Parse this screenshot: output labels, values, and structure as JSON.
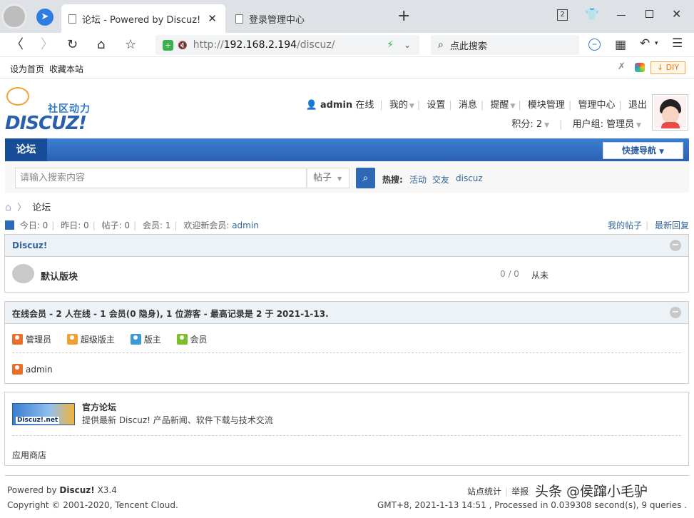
{
  "browser": {
    "tabs": [
      {
        "title": "论坛 - Powered by Discuz!",
        "active": true
      },
      {
        "title": "登录管理中心",
        "active": false
      }
    ],
    "tab_count": "2",
    "url_prefix": "http://",
    "url_host": "192.168.2.194",
    "url_path": "/discuz/",
    "search_placeholder": "点此搜索",
    "bookmarks": [
      "设为首页",
      "收藏本站"
    ],
    "diy_label": "DIY"
  },
  "site": {
    "logo_tagline": "社区动力",
    "logo_text": "DISCUZ!",
    "user": {
      "name": "admin",
      "status": "在线",
      "links": [
        "我的",
        "设置",
        "消息",
        "提醒",
        "模块管理",
        "管理中心",
        "退出"
      ],
      "credits_label": "积分: 2",
      "usergroup_label": "用户组: 管理员"
    },
    "nav": {
      "current": "论坛",
      "quick_nav": "快捷导航"
    },
    "search": {
      "placeholder": "请输入搜索内容",
      "type": "帖子",
      "hot_label": "热搜:",
      "hot_terms": [
        "活动",
        "交友",
        "discuz"
      ]
    },
    "breadcrumb": "论坛",
    "stats": {
      "today": "今日: 0",
      "yesterday": "昨日: 0",
      "posts": "帖子: 0",
      "members": "会员: 1",
      "welcome_prefix": "欢迎新会员:",
      "newest_member": "admin",
      "my_posts": "我的帖子",
      "latest_reply": "最新回复"
    },
    "category": {
      "title": "Discuz!",
      "forums": [
        {
          "name": "默认版块",
          "counts": "0 / 0",
          "last": "从未"
        }
      ]
    },
    "online": {
      "title": "在线会员 - 2 人在线 - 1 会员(0 隐身), 1 位游客 - 最高记录是 2 于 2021-1-13.",
      "legend": [
        {
          "label": "管理员",
          "color": "#e8702a"
        },
        {
          "label": "超级版主",
          "color": "#f0a030"
        },
        {
          "label": "版主",
          "color": "#3a9ad9"
        },
        {
          "label": "会员",
          "color": "#7bbf2a"
        }
      ],
      "users": [
        "admin"
      ]
    },
    "links": {
      "site_name": "官方论坛",
      "site_desc": "提供最新 Discuz! 产品新闻、软件下载与技术交流",
      "banner_text": "Discuz!.net",
      "app_store": "应用商店"
    },
    "footer": {
      "powered_prefix": "Powered by",
      "powered_name": "Discuz!",
      "version": "X3.4",
      "copyright": "Copyright © 2001-2020, Tencent Cloud.",
      "links": [
        "站点统计",
        "举报"
      ],
      "time_info": "GMT+8, 2021-1-13 14:51 , Processed in 0.039308 second(s), 9 queries .",
      "watermark": "头条 @侯蹿小毛驴"
    }
  }
}
